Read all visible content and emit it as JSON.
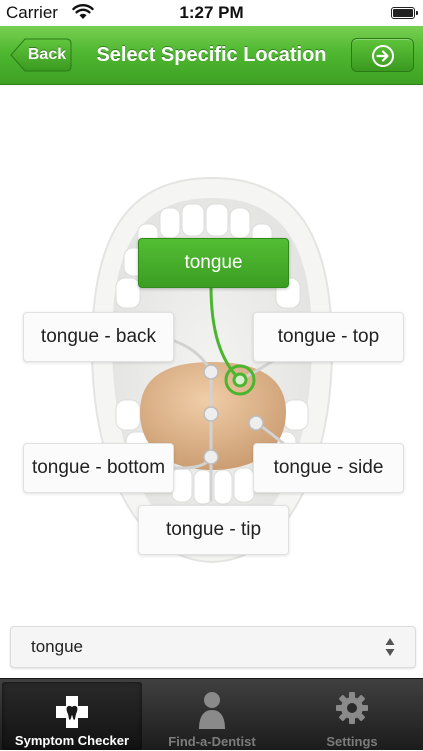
{
  "status_bar": {
    "carrier": "Carrier",
    "time": "1:27 PM"
  },
  "nav": {
    "back_label": "Back",
    "title": "Select Specific Location",
    "forward_icon": "arrow-right-circle-icon"
  },
  "locations": {
    "tongue": "tongue",
    "back": "tongue - back",
    "top": "tongue - top",
    "bottom": "tongue - bottom",
    "side": "tongue - side",
    "tip": "tongue - tip",
    "selected": "tongue"
  },
  "picker": {
    "value": "tongue"
  },
  "tabs": [
    {
      "label": "Symptom Checker",
      "icon": "tooth-cross-icon",
      "active": true
    },
    {
      "label": "Find-a-Dentist",
      "icon": "person-icon",
      "active": false
    },
    {
      "label": "Settings",
      "icon": "gear-icon",
      "active": false
    }
  ],
  "colors": {
    "accent_green": "#4cb52f",
    "tab_bar": "#2b2b2b",
    "tongue": "#d9b08a"
  }
}
